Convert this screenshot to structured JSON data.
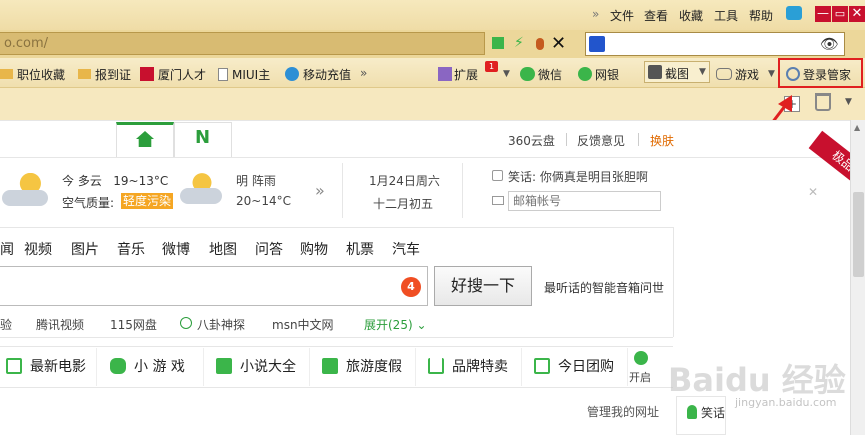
{
  "menubar": {
    "items": [
      "文件",
      "查看",
      "收藏",
      "工具",
      "帮助"
    ]
  },
  "address": {
    "url_text": "o.com/"
  },
  "favorites": {
    "items": [
      "职位收藏",
      "报到证",
      "厦门人才",
      "MIUI主",
      "移动充值"
    ]
  },
  "toolbar": {
    "extensions": "扩展",
    "extension_badge": "1",
    "wechat": "微信",
    "bank": "网银",
    "screenshot": "截图",
    "games": "游戏",
    "login_manager": "登录管家"
  },
  "header_links": {
    "cloud": "360云盘",
    "feedback": "反馈意见",
    "skin": "换肤"
  },
  "weather": {
    "today_desc": "今 多云",
    "today_temp": "19~13°C",
    "air_label": "空气质量:",
    "air_value": "轻度污染",
    "tomorrow_desc": "明 阵雨",
    "tomorrow_temp": "20~14°C"
  },
  "date": {
    "solar": "1月24日周六",
    "lunar": "十二月初五"
  },
  "joke": "笑话: 你俩真是明目张胆啊",
  "mail_placeholder": "邮箱帐号",
  "corner_ribbon": "极品",
  "nav_links": [
    "闻",
    "视频",
    "图片",
    "音乐",
    "微博",
    "地图",
    "问答",
    "购物",
    "机票",
    "汽车"
  ],
  "search": {
    "badge": "4",
    "button": "好搜一下",
    "hint": "最听话的智能音箱问世"
  },
  "quick_links": [
    "验",
    "腾讯视频",
    "115网盘",
    "八卦神探",
    "msn中文网"
  ],
  "expand": "展开(25)",
  "categories": [
    "最新电影",
    "小 游 戏",
    "小说大全",
    "旅游度假",
    "品牌特卖",
    "今日团购"
  ],
  "open_label": "开启",
  "manage_sites": "管理我的网址",
  "joke_tab": "笑话",
  "watermark": "Baidu 经验",
  "watermark_url": "jingyan.baidu.com",
  "colors": {
    "highlight_red": "#e02020",
    "air_badge": "#f5a623",
    "accent_green": "#2c9e3c",
    "skin_orange": "#e06a00"
  }
}
